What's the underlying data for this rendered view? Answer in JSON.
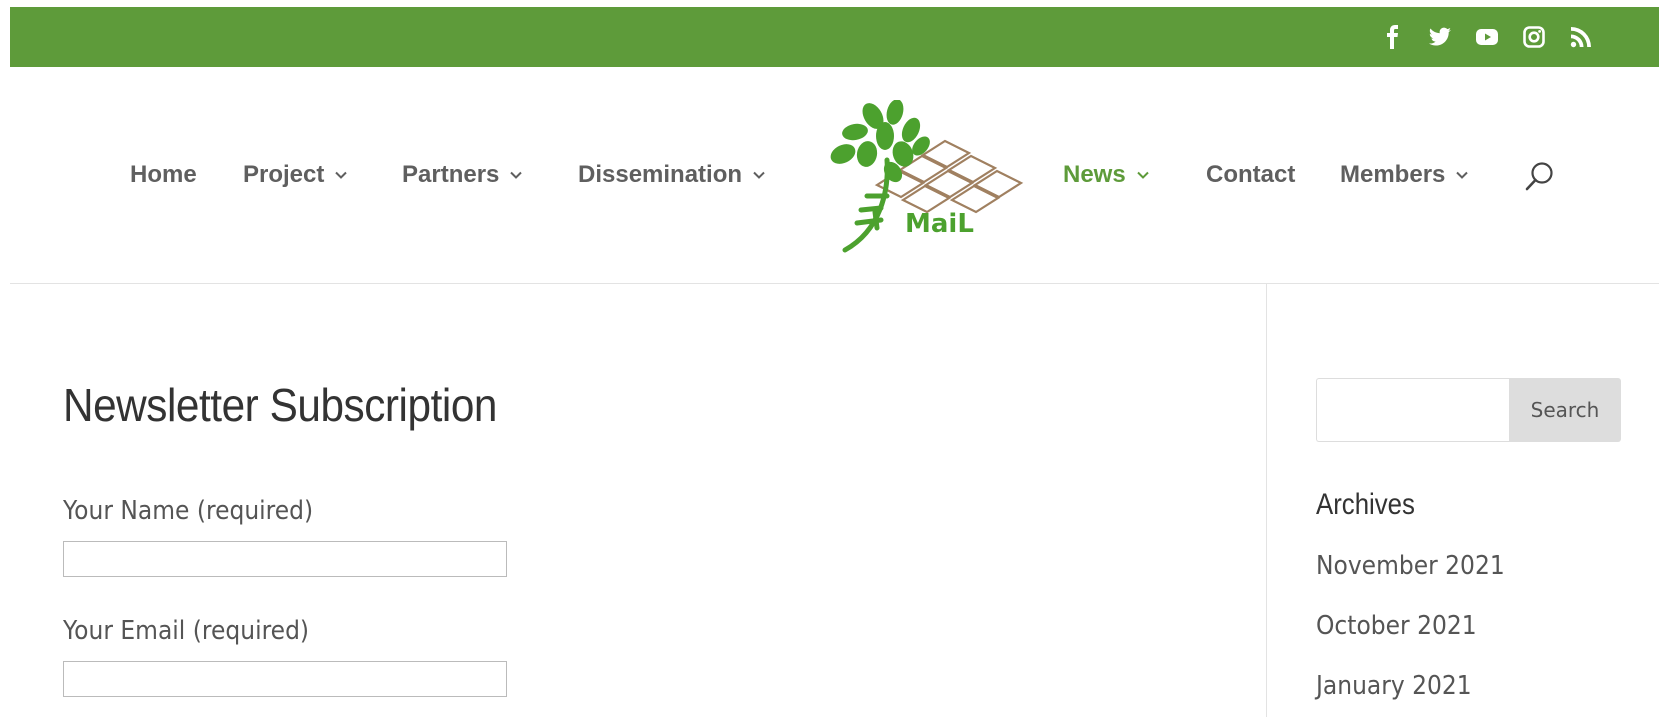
{
  "colors": {
    "brand_green": "#5e9b3a",
    "nav_text": "#5f5f5f",
    "logo_brown": "#a08060"
  },
  "social": {
    "icons": [
      "facebook-icon",
      "twitter-icon",
      "youtube-icon",
      "instagram-icon",
      "rss-icon"
    ]
  },
  "nav": {
    "items": [
      {
        "label": "Home",
        "has_dropdown": false
      },
      {
        "label": "Project",
        "has_dropdown": true
      },
      {
        "label": "Partners",
        "has_dropdown": true
      },
      {
        "label": "Dissemination",
        "has_dropdown": true
      },
      {
        "label": "News",
        "has_dropdown": true,
        "active": true
      },
      {
        "label": "Contact",
        "has_dropdown": false
      },
      {
        "label": "Members",
        "has_dropdown": true
      }
    ],
    "logo_text": "MaiL"
  },
  "main": {
    "title": "Newsletter Subscription",
    "fields": [
      {
        "label": "Your Name (required)",
        "value": ""
      },
      {
        "label": "Your Email (required)",
        "value": ""
      }
    ]
  },
  "sidebar": {
    "search": {
      "value": "",
      "button_label": "Search"
    },
    "archives": {
      "title": "Archives",
      "items": [
        "November 2021",
        "October 2021",
        "January 2021"
      ]
    }
  }
}
